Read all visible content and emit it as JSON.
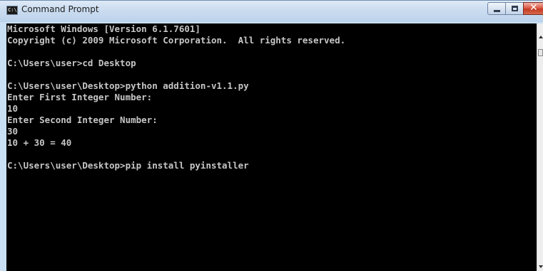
{
  "window": {
    "title": "Command Prompt",
    "icon": "cmd-icon",
    "icon_glyph": "C:\\",
    "controls": {
      "minimize": "minimize-icon",
      "maximize": "maximize-icon",
      "close": "close-icon",
      "close_glyph": "✕"
    }
  },
  "console": {
    "lines": [
      "Microsoft Windows [Version 6.1.7601]",
      "Copyright (c) 2009 Microsoft Corporation.  All rights reserved.",
      "",
      "C:\\Users\\user>cd Desktop",
      "",
      "C:\\Users\\user\\Desktop>python addition-v1.1.py",
      "Enter First Integer Number:",
      "10",
      "Enter Second Integer Number:",
      "30",
      "10 + 30 = 40",
      "",
      "C:\\Users\\user\\Desktop>pip install pyinstaller"
    ]
  },
  "colors": {
    "console_background": "#000000",
    "console_text": "#c6c6c6",
    "titlebar": "#cadcf0",
    "close_button": "#c23a24"
  }
}
